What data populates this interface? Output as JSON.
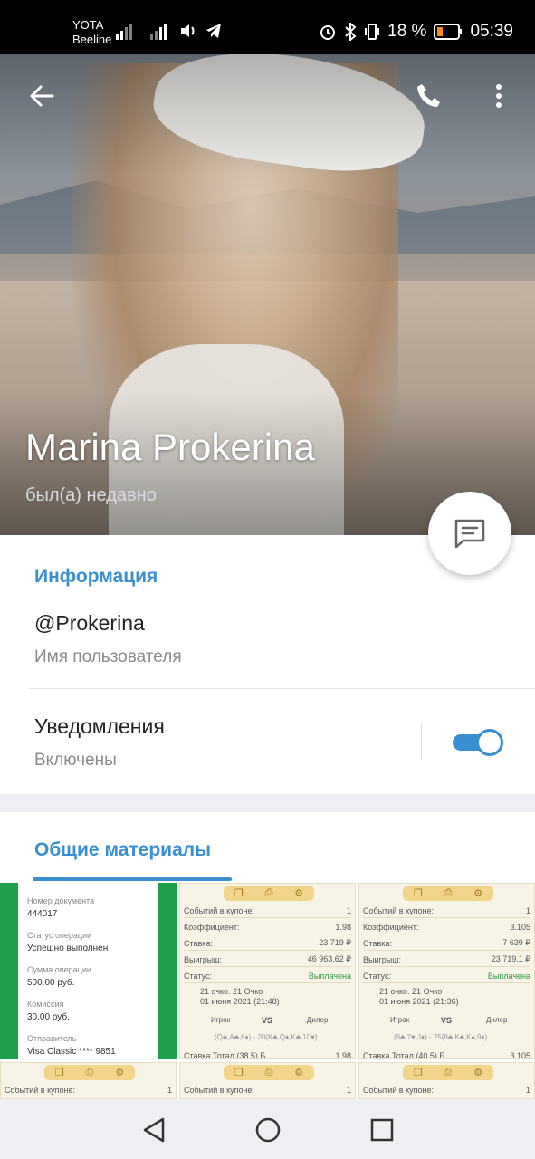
{
  "status_bar": {
    "carrier_1": "YOTA",
    "carrier_2": "Beeline",
    "battery": "18 %",
    "time": "05:39"
  },
  "header": {
    "back_icon": "arrow-left-icon",
    "call_icon": "phone-icon",
    "more_icon": "more-vertical-icon"
  },
  "profile": {
    "name": "Marina Prokerina",
    "status": "был(а) недавно"
  },
  "info": {
    "section_title": "Информация",
    "username": "@Prokerina",
    "username_label": "Имя пользователя",
    "notifications_title": "Уведомления",
    "notifications_state": "Включены",
    "notifications_on": true
  },
  "media": {
    "section_title": "Общие материалы",
    "receipt": {
      "doc_number_label": "Номер документа",
      "doc_number": "444017",
      "status_label": "Статус операции",
      "status": "Успешно выполнен",
      "amount_label": "Сумма операции",
      "amount": "500.00 руб.",
      "fee_label": "Комиссия",
      "fee": "30.00 руб.",
      "sender_label": "Отправитель",
      "sender": "Visa Classic **** 9851"
    },
    "coupon_1": {
      "events_label": "Событий в купоне:",
      "events": "1",
      "coef_label": "Коэффициент:",
      "coef": "1.98",
      "stake_label": "Ставка:",
      "stake": "23 719 ₽",
      "win_label": "Выигрыш:",
      "win": "46 963.62 ₽",
      "status_label": "Статус:",
      "status": "Выплачена",
      "game": "21 очко. 21 Очко",
      "date": "01 июня 2021 (21:48)",
      "player": "Игрок",
      "vs": "VS",
      "dealer": "Дилер",
      "cards": "(Q♣,A♣,6♦) - 20(K♣,Q♦,K♣,10♥)",
      "bet_line": "Ставка  Тотал (38.5) Б",
      "bet_coef": "1.98"
    },
    "coupon_2": {
      "events_label": "Событий в купоне:",
      "events": "1",
      "coef_label": "Коэффициент:",
      "coef": "3.105",
      "stake_label": "Ставка:",
      "stake": "7 639 ₽",
      "win_label": "Выигрыш:",
      "win": "23 719.1 ₽",
      "status_label": "Статус:",
      "status": "Выплачена",
      "game": "21 очко. 21 Очко",
      "date": "01 июня 2021 (21:36)",
      "player": "Игрок",
      "vs": "VS",
      "dealer": "Дилер",
      "cards": "(9♣,7♥,J♦) - 25(8♣,K♣,K♠,9♦)",
      "bet_line": "Ставка  Тотал (40.5) Б",
      "bet_coef": "3.105"
    },
    "coupon_3_events_label": "Событий в купоне:",
    "coupon_3_events": "1"
  },
  "nav": {
    "back_icon": "triangle-back-icon",
    "home_icon": "circle-home-icon",
    "recents_icon": "square-recents-icon"
  },
  "colors": {
    "accent": "#3a8fd0",
    "receipt_green": "#1fa14c"
  }
}
